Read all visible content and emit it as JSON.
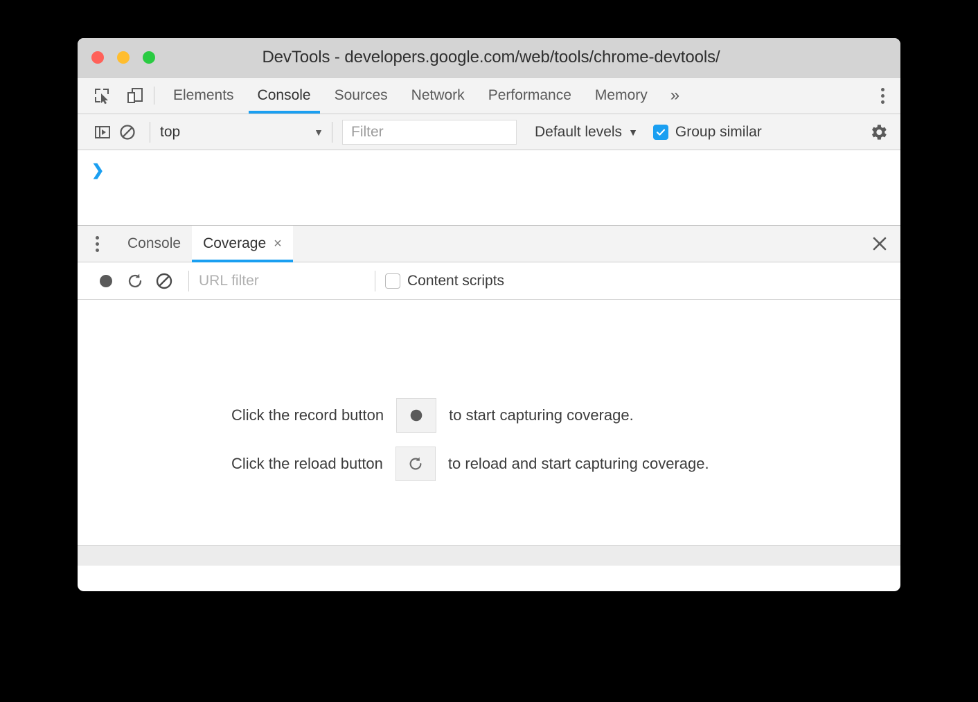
{
  "window": {
    "title": "DevTools - developers.google.com/web/tools/chrome-devtools/",
    "traffic_lights": [
      {
        "name": "close",
        "color": "#ff6159"
      },
      {
        "name": "minimize",
        "color": "#ffbd2e"
      },
      {
        "name": "zoom",
        "color": "#2acb42"
      }
    ]
  },
  "main_toolbar": {
    "inspect_icon": "inspect-element-icon",
    "device_icon": "device-toolbar-icon",
    "more_tabs_label": "»",
    "menu_icon": "vertical-dots-icon",
    "tabs": [
      {
        "label": "Elements",
        "active": false
      },
      {
        "label": "Console",
        "active": true
      },
      {
        "label": "Sources",
        "active": false
      },
      {
        "label": "Network",
        "active": false
      },
      {
        "label": "Performance",
        "active": false
      },
      {
        "label": "Memory",
        "active": false
      }
    ]
  },
  "console_toolbar": {
    "sidebar_icon": "console-sidebar-icon",
    "clear_icon": "clear-console-icon",
    "context_value": "top",
    "context_caret": "▼",
    "filter_placeholder": "Filter",
    "levels_label": "Default levels",
    "levels_caret": "▼",
    "group_similar_label": "Group similar",
    "group_similar_checked": true,
    "settings_icon": "gear-icon"
  },
  "console_output": {
    "prompt": "❯"
  },
  "drawer": {
    "menu_icon": "vertical-dots-icon",
    "tabs": [
      {
        "label": "Console",
        "active": false,
        "closable": false
      },
      {
        "label": "Coverage",
        "active": true,
        "closable": true,
        "close_label": "×"
      }
    ],
    "close_label": "✕"
  },
  "coverage_toolbar": {
    "record_icon": "record-icon",
    "reload_icon": "reload-icon",
    "clear_icon": "clear-icon",
    "url_filter_placeholder": "URL filter",
    "content_scripts_label": "Content scripts",
    "content_scripts_checked": false
  },
  "coverage_empty_state": {
    "rows": [
      {
        "lead": "Click the record button",
        "icon": "record-icon",
        "tail": "to start capturing coverage."
      },
      {
        "lead": "Click the reload button",
        "icon": "reload-icon",
        "tail": "to reload and start capturing coverage."
      }
    ]
  },
  "colors": {
    "accent_blue": "#1a9ff1",
    "titlebar_grey": "#d4d4d4",
    "toolbar_grey": "#f3f3f3",
    "status_grey": "#ececec"
  }
}
